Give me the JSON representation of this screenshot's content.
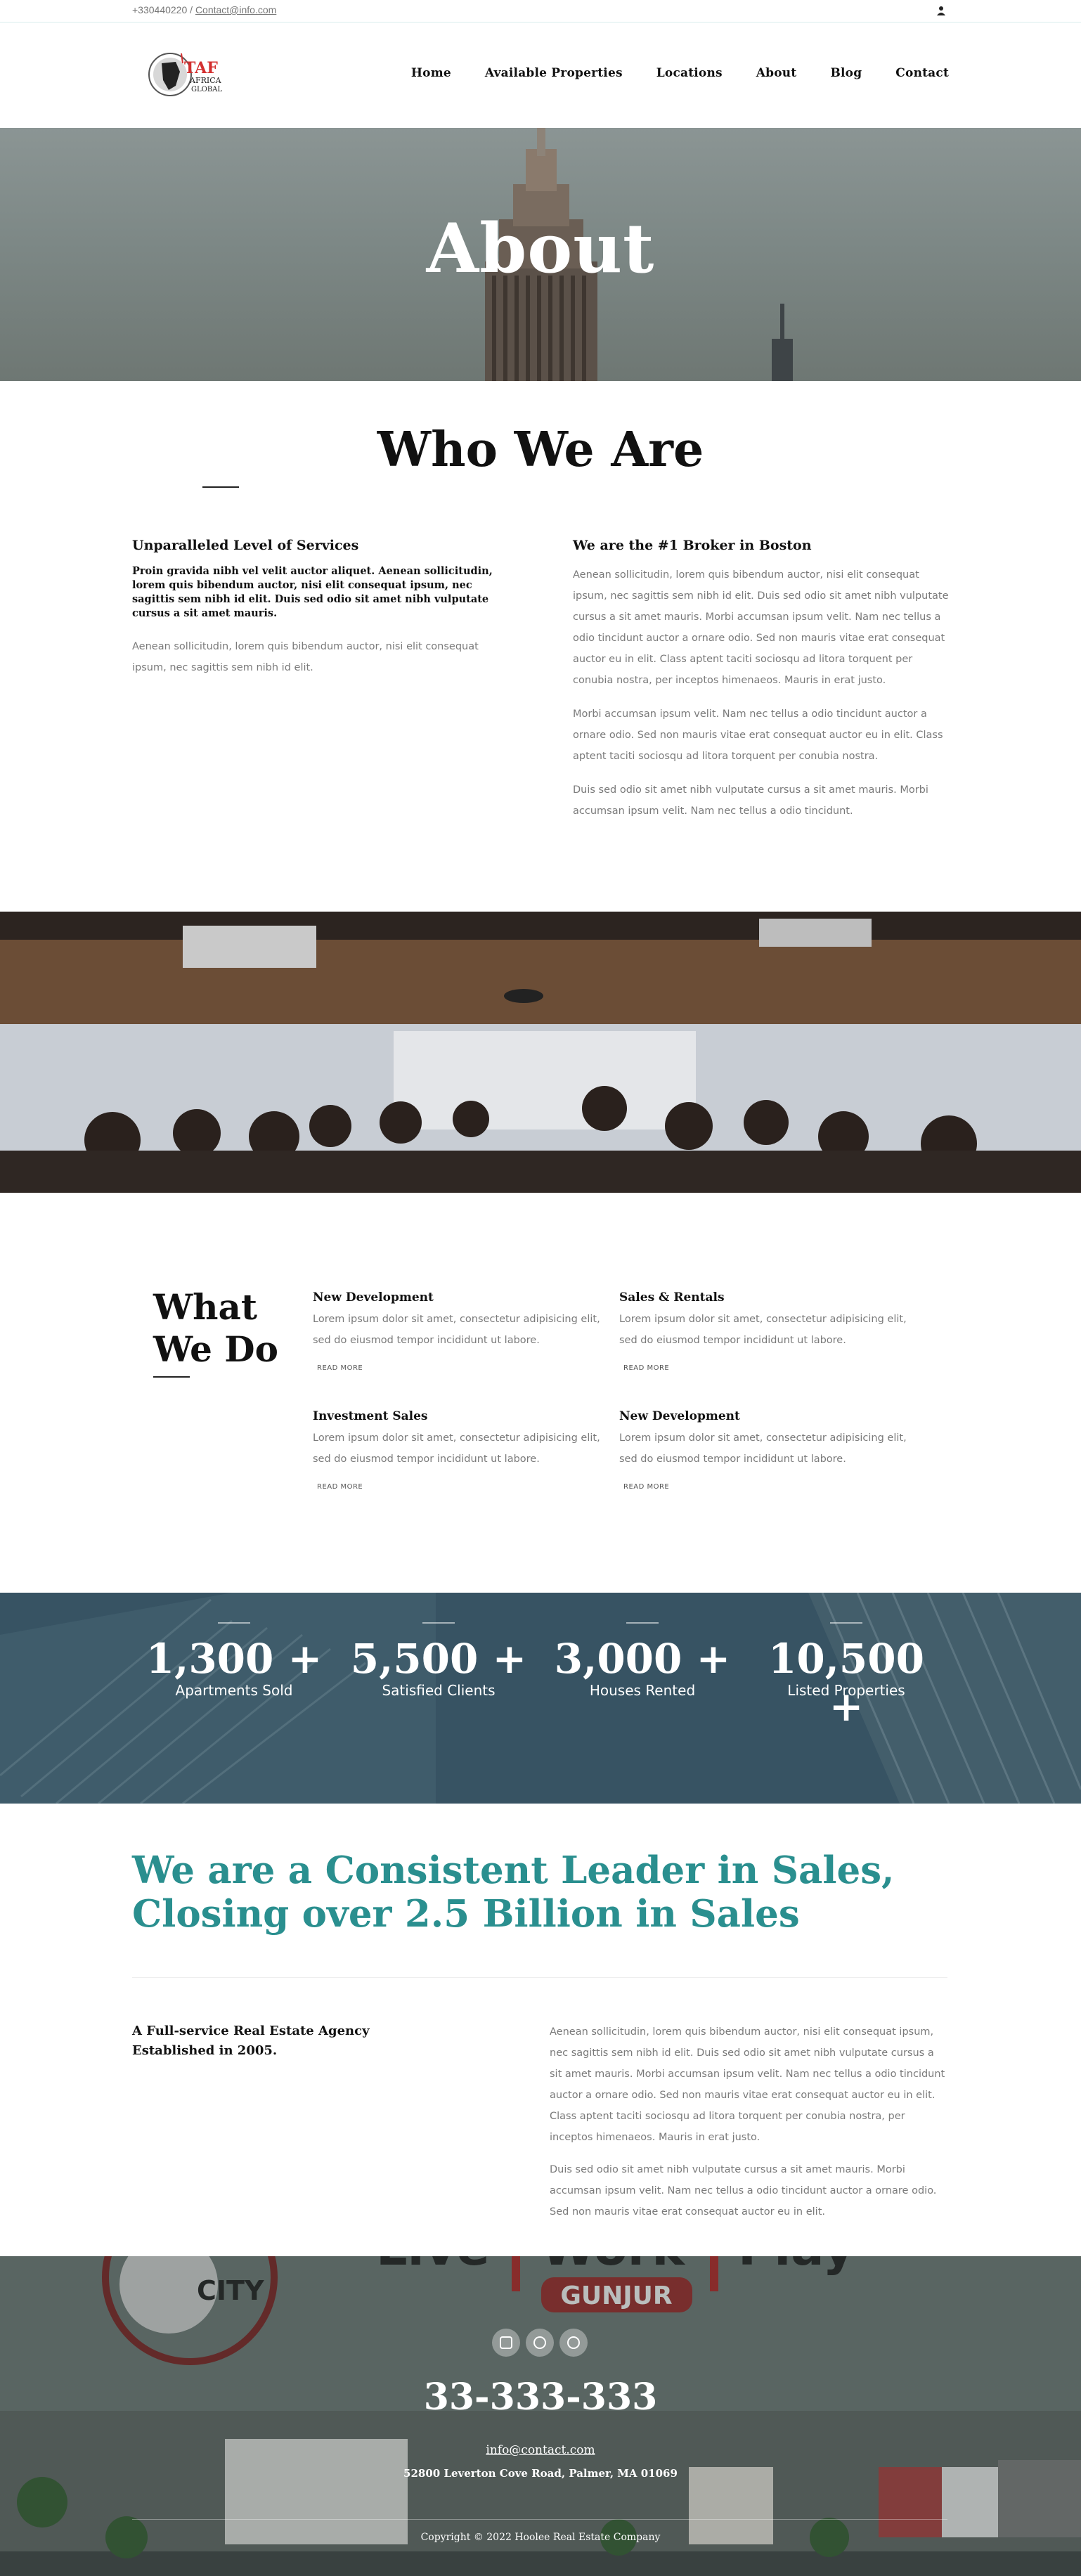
{
  "topbar": {
    "phone": "+330440220",
    "separator": " / ",
    "email": "Contact@info.com",
    "user_icon": "user-icon"
  },
  "header": {
    "logo": {
      "brand": "TAF",
      "line1": "AFRICA",
      "line2": "GLOBAL"
    },
    "nav": [
      "Home",
      "Available Properties",
      "Locations",
      "About",
      "Blog",
      "Contact"
    ]
  },
  "hero": {
    "title": "About"
  },
  "who": {
    "title": "Who We Are",
    "left": {
      "heading": "Unparalleled Level of Services",
      "bold": "Proin gravida nibh vel velit auctor aliquet. Aenean sollicitudin, lorem quis bibendum auctor, nisi elit consequat ipsum, nec sagittis sem nibh id elit. Duis sed odio sit amet nibh vulputate cursus a sit amet mauris.",
      "text": "Aenean sollicitudin, lorem quis bibendum auctor, nisi elit consequat ipsum, nec sagittis sem nibh id elit."
    },
    "right": {
      "heading": "We are the #1 Broker in Boston",
      "p1": "Aenean sollicitudin, lorem quis bibendum auctor, nisi elit consequat ipsum, nec sagittis sem nibh id elit. Duis sed odio sit amet nibh vulputate cursus a sit amet mauris. Morbi accumsan ipsum velit. Nam nec tellus a odio tincidunt auctor a ornare odio. Sed non mauris vitae erat consequat auctor eu in elit. Class aptent taciti sociosqu ad litora torquent per conubia nostra, per inceptos himenaeos. Mauris in erat justo.",
      "p2": "Morbi accumsan ipsum velit. Nam nec tellus a odio tincidunt auctor a ornare odio. Sed non mauris vitae erat consequat auctor eu in elit. Class aptent taciti sociosqu ad litora torquent per conubia nostra.",
      "p3": "Duis sed odio sit amet nibh vulputate cursus a sit amet mauris. Morbi accumsan ipsum velit. Nam nec tellus a odio tincidunt."
    }
  },
  "what": {
    "title_line1": "What",
    "title_line2": "We Do",
    "services": [
      {
        "title": "New Development",
        "text": "Lorem ipsum dolor sit amet, consectetur adipisicing elit, sed do eiusmod tempor incididunt ut labore.",
        "link": "READ MORE"
      },
      {
        "title": "Sales & Rentals",
        "text": "Lorem ipsum dolor sit amet, consectetur adipisicing elit, sed do eiusmod tempor incididunt ut labore.",
        "link": "READ MORE"
      },
      {
        "title": "Investment Sales",
        "text": "Lorem ipsum dolor sit amet, consectetur adipisicing elit, sed do eiusmod tempor incididunt ut labore.",
        "link": "READ MORE"
      },
      {
        "title": "New Development",
        "text": "Lorem ipsum dolor sit amet, consectetur adipisicing elit, sed do eiusmod tempor incididunt ut labore.",
        "link": "READ MORE"
      }
    ]
  },
  "stats": [
    {
      "value": "1,300 +",
      "label": "Apartments Sold"
    },
    {
      "value": "5,500 +",
      "label": "Satisfied Clients"
    },
    {
      "value": "3,000 +",
      "label": "Houses Rented"
    },
    {
      "value": "10,500 +",
      "label": "Listed Properties"
    }
  ],
  "leader": {
    "title_line1": "We are a Consistent Leader in Sales,",
    "title_line2": "Closing over 2.5 Billion in Sales",
    "agency_line1": "A Full-service Real Estate Agency",
    "agency_line2": "Established in 2005.",
    "p1": "Aenean sollicitudin, lorem quis bibendum auctor, nisi elit consequat ipsum, nec sagittis sem nibh id elit. Duis sed odio sit amet nibh vulputate cursus a sit amet mauris. Morbi accumsan ipsum velit. Nam nec tellus a odio tincidunt auctor a ornare odio. Sed non mauris vitae erat consequat auctor eu in elit. Class aptent taciti sociosqu ad litora torquent per conubia nostra, per inceptos himenaeos. Mauris in erat justo.",
    "p2": "Duis sed odio sit amet nibh vulputate cursus a sit amet mauris. Morbi accumsan ipsum velit. Nam nec tellus a odio tincidunt auctor a ornare odio. Sed non mauris vitae erat consequat auctor eu in elit."
  },
  "footer": {
    "banner": {
      "city": "CITY",
      "live": "Live",
      "work": "Work",
      "play": "Play",
      "place": "GUNJUR"
    },
    "social": [
      "facebook-icon",
      "instagram-icon",
      "instagram-icon"
    ],
    "phone": "33-333-333",
    "email": "info@contact.com",
    "address": "52800 Leverton Cove Road, Palmer, MA 01069",
    "copyright": "Copyright © 2022 Hoolee Real Estate Company"
  },
  "colors": {
    "accent": "#2a8f8f",
    "brand_red": "#d32f2f",
    "stats_bg": "#3f5a6b"
  }
}
